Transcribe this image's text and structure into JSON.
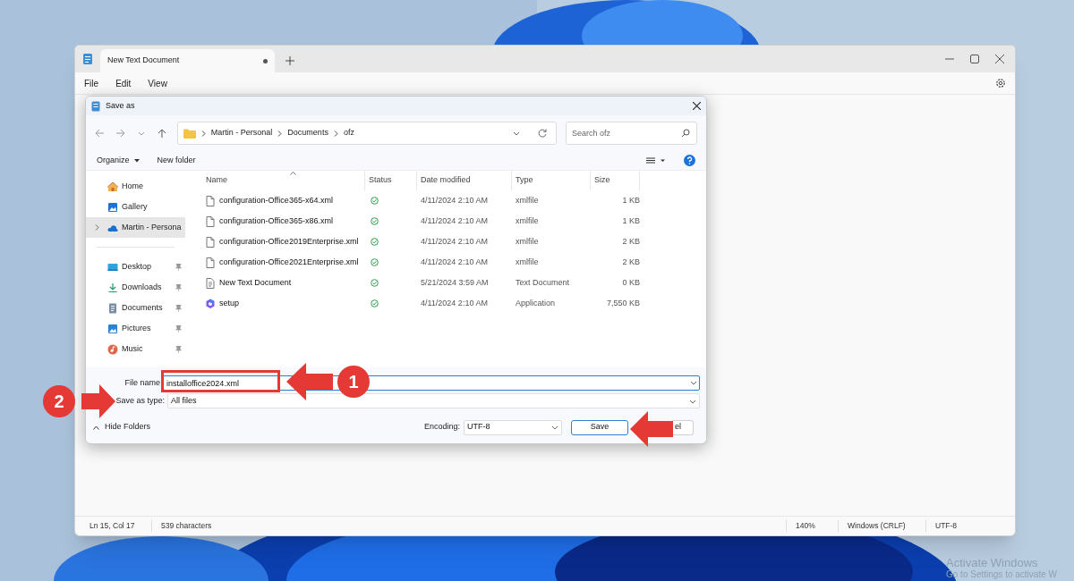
{
  "notepad": {
    "tabs": [
      {
        "label": "New Text Document",
        "selected": true,
        "unsaved": true
      }
    ],
    "menu": [
      "File",
      "Edit",
      "View"
    ],
    "status_bar": [
      "Ln 15, Col 17",
      "539 characters",
      "140%",
      "Windows (CRLF)",
      "UTF-8"
    ]
  },
  "dialog": {
    "title": "Save as",
    "breadcrumb": [
      "Martin - Personal",
      "Documents",
      "ofz"
    ],
    "search": {
      "placeholder": "Search ofz"
    },
    "toolbar": [
      "Organize",
      "New folder"
    ],
    "sidebar": [
      {
        "label": "Home",
        "kind": "home",
        "pinned": false,
        "selected": false
      },
      {
        "label": "Gallery",
        "kind": "gallery",
        "pinned": false,
        "selected": false
      },
      {
        "label": "Martin - Persona",
        "kind": "cloud",
        "pinned": false,
        "selected": true
      },
      {
        "label": "Desktop",
        "kind": "desktop",
        "pinned": true,
        "selected": false
      },
      {
        "label": "Downloads",
        "kind": "download",
        "pinned": true,
        "selected": false
      },
      {
        "label": "Documents",
        "kind": "documents",
        "pinned": true,
        "selected": false
      },
      {
        "label": "Pictures",
        "kind": "pictures",
        "pinned": true,
        "selected": false
      },
      {
        "label": "Music",
        "kind": "music",
        "pinned": true,
        "selected": false
      }
    ],
    "columns": [
      "Name",
      "Status",
      "Date modified",
      "Type",
      "Size"
    ],
    "rows": [
      {
        "name": "configuration-Office365-x64.xml",
        "kind": "file",
        "synced": true,
        "date": "4/11/2024 2:10 AM",
        "type": "xmlfile",
        "size": "1 KB"
      },
      {
        "name": "configuration-Office365-x86.xml",
        "kind": "file",
        "synced": true,
        "date": "4/11/2024 2:10 AM",
        "type": "xmlfile",
        "size": "1 KB"
      },
      {
        "name": "configuration-Office2019Enterprise.xml",
        "kind": "file",
        "synced": true,
        "date": "4/11/2024 2:10 AM",
        "type": "xmlfile",
        "size": "2 KB"
      },
      {
        "name": "configuration-Office2021Enterprise.xml",
        "kind": "file",
        "synced": true,
        "date": "4/11/2024 2:10 AM",
        "type": "xmlfile",
        "size": "2 KB"
      },
      {
        "name": "New Text Document",
        "kind": "text",
        "synced": true,
        "date": "5/21/2024 3:59 AM",
        "type": "Text Document",
        "size": "0 KB"
      },
      {
        "name": "setup",
        "kind": "app",
        "synced": true,
        "date": "4/11/2024 2:10 AM",
        "type": "Application",
        "size": "7,550 KB"
      }
    ],
    "file_name": {
      "label": "File name",
      "value": "installoffice2024.xml"
    },
    "save_as_type": {
      "label": "Save as type:",
      "value": "All files"
    },
    "hide_folders": "Hide Folders",
    "encoding": {
      "label": "Encoding:",
      "value": "UTF-8"
    },
    "buttons": [
      {
        "label": "Save",
        "kind": "primary"
      },
      {
        "label": "el",
        "kind": "secondary"
      }
    ]
  },
  "annotations": [
    {
      "kind": "step",
      "label": "1"
    },
    {
      "kind": "step",
      "label": "2"
    }
  ],
  "activation": [
    "Activate Windows",
    "Go to Settings to activate W"
  ]
}
